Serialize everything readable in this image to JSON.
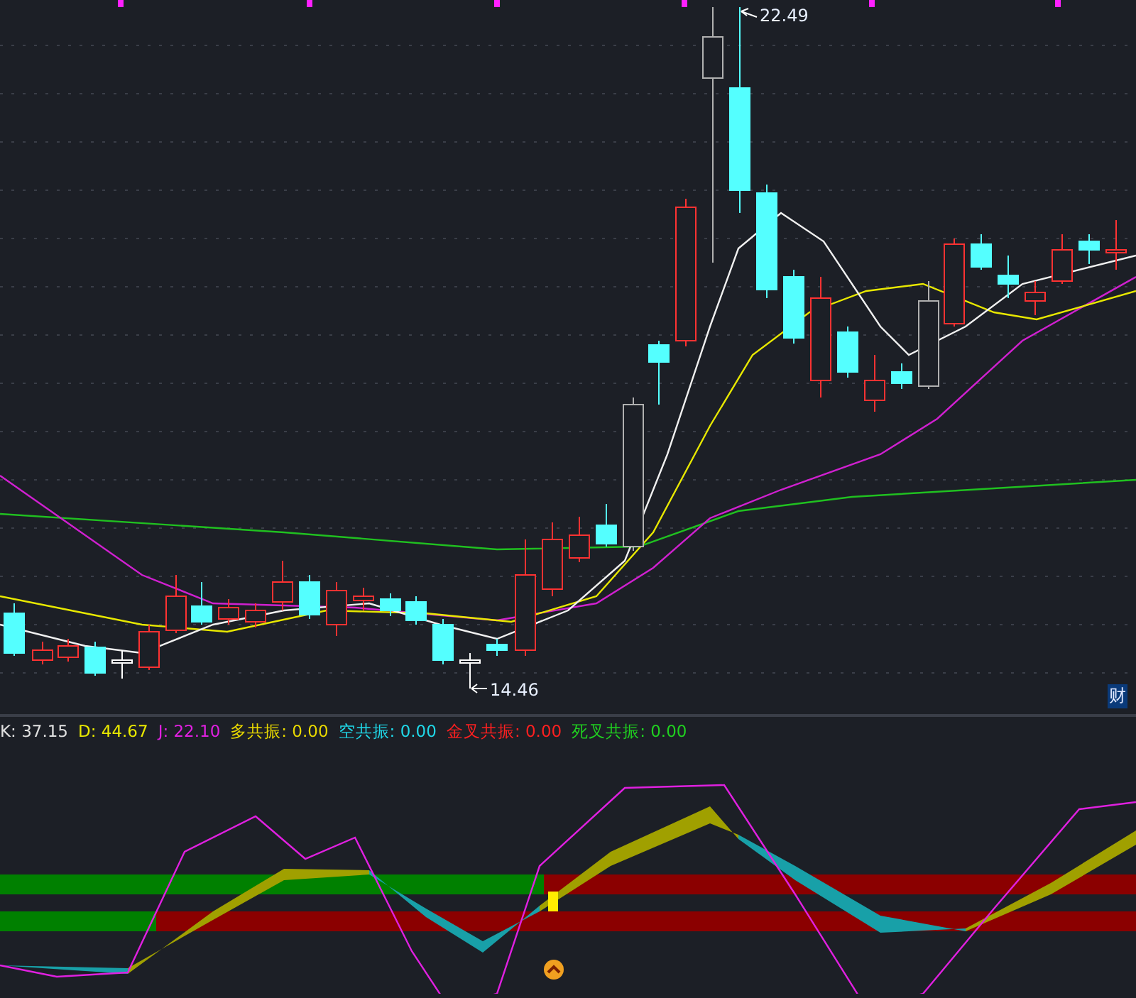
{
  "main_chart": {
    "high_label": "22.49",
    "low_label": "14.46",
    "corner_label": "财"
  },
  "indicator": {
    "legend": [
      {
        "label": "K:",
        "value": "37.15",
        "color": "#e0e0e0"
      },
      {
        "label": "D:",
        "value": "44.67",
        "color": "#e8e800"
      },
      {
        "label": "J:",
        "value": "22.10",
        "color": "#e020e0"
      },
      {
        "label": "多共振:",
        "value": "0.00",
        "color": "#e8d800"
      },
      {
        "label": "空共振:",
        "value": "0.00",
        "color": "#20d8e8"
      },
      {
        "label": "金叉共振:",
        "value": "0.00",
        "color": "#ff2020"
      },
      {
        "label": "死叉共振:",
        "value": "0.00",
        "color": "#20d020"
      }
    ]
  }
}
